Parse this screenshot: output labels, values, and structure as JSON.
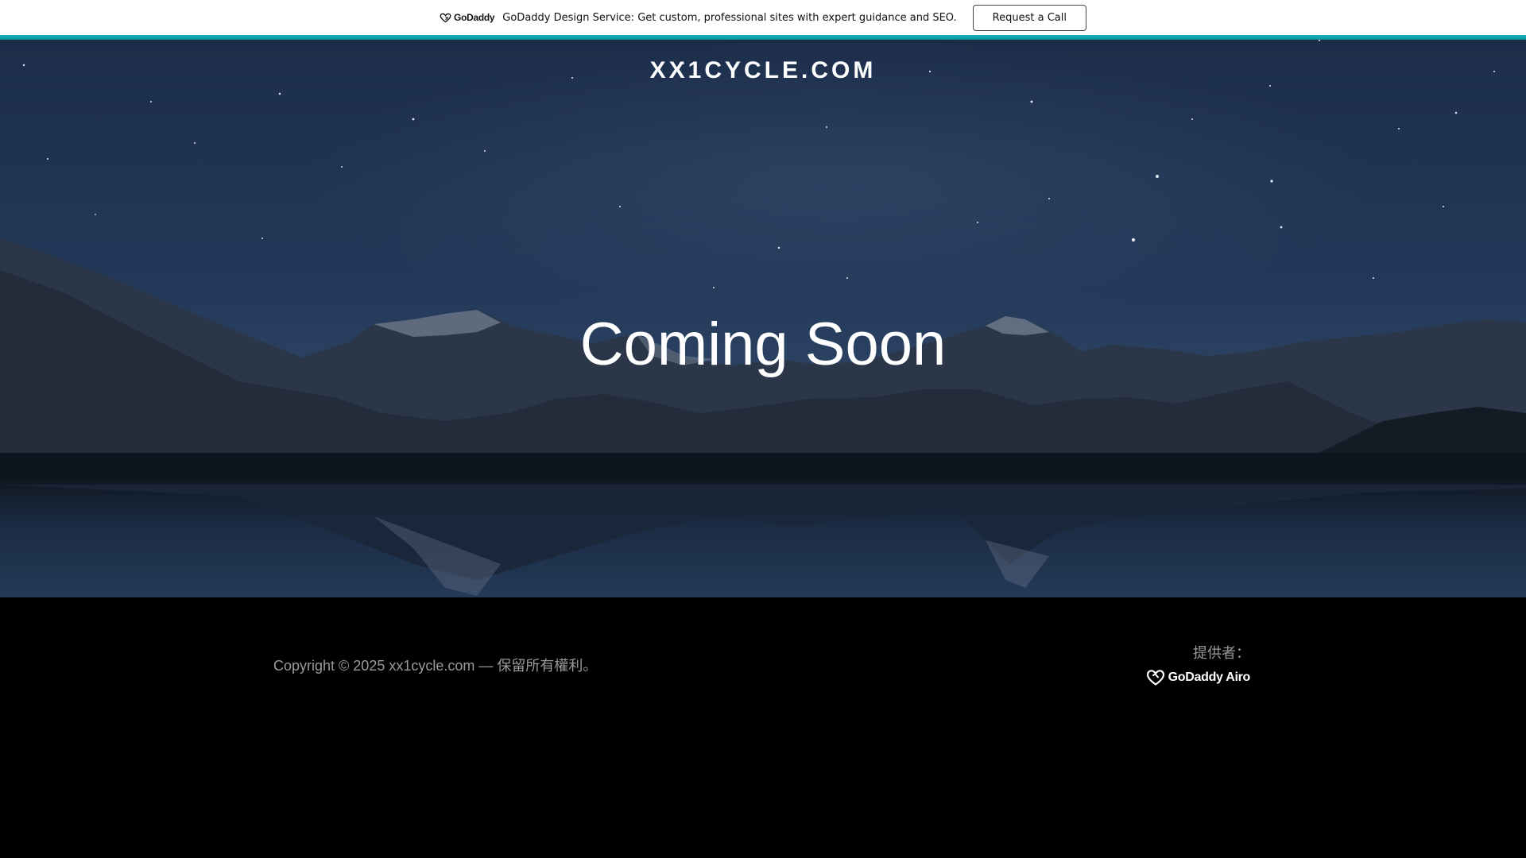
{
  "promo": {
    "logo_text": "GoDaddy",
    "message": "GoDaddy Design Service: Get custom, professional sites with expert guidance and SEO.",
    "button_label": "Request a Call",
    "accent_color": "#1bb5bd"
  },
  "hero": {
    "site_title": "XX1CYCLE.COM",
    "heading": "Coming Soon",
    "background": "night-sky-mountain-lake"
  },
  "footer": {
    "copyright": "Copyright © 2025 xx1cycle.com — 保留所有權利。",
    "powered_by_label": "提供者：",
    "powered_by_logo": "GoDaddy Airo"
  }
}
